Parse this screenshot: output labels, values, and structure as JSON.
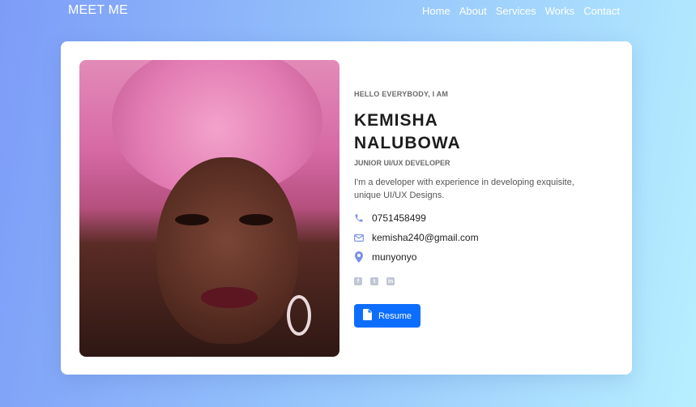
{
  "brand": "MEET ME",
  "nav": [
    "Home",
    "About",
    "Services",
    "Works",
    "Contact"
  ],
  "profile": {
    "greeting": "HELLO EVERYBODY, I AM",
    "first_name": "KEMISHA",
    "last_name": "NALUBOWA",
    "role": "JUNIOR UI/UX DEVELOPER",
    "description": "I'm a developer with experience in developing exquisite, unique UI/UX Designs.",
    "phone": "0751458499",
    "email": "kemisha240@gmail.com",
    "location": "munyonyo"
  },
  "socials": [
    "facebook-icon",
    "twitter-icon",
    "linkedin-icon"
  ],
  "resume_label": "Resume",
  "colors": {
    "accent": "#0d6efd",
    "icon": "#7a8fe6"
  }
}
